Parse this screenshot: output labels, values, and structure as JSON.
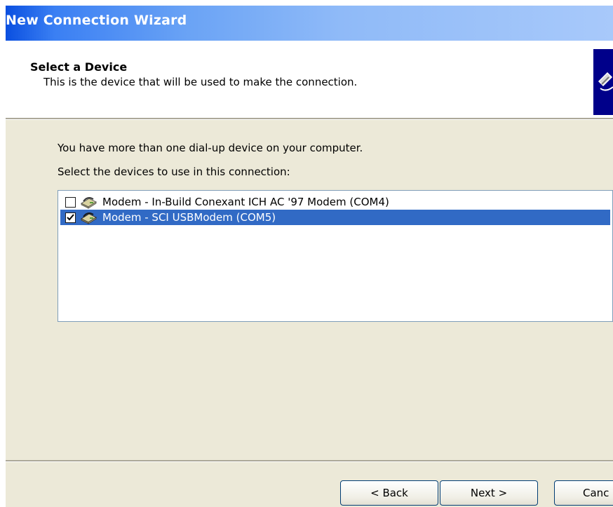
{
  "window": {
    "title": "New Connection Wizard"
  },
  "header": {
    "title": "Select a Device",
    "subtitle": "This is the device that will be used to make the connection.",
    "image_icon": "connection-wizard-icon"
  },
  "body": {
    "intro_text": "You have more than one dial-up device on your computer.",
    "instruction_text": "Select the devices to use in this connection:",
    "devices": [
      {
        "label": "Modem - In-Build Conexant ICH AC '97 Modem (COM4)",
        "checked": false,
        "selected": false,
        "icon": "modem-icon"
      },
      {
        "label": "Modem - SCI USBModem (COM5)",
        "checked": true,
        "selected": true,
        "icon": "modem-icon"
      }
    ]
  },
  "buttons": {
    "back": "< Back",
    "next": "Next >",
    "cancel": "Canc"
  },
  "colors": {
    "title_bar_start": "#0a4fe0",
    "title_bar_end": "#a8c9fa",
    "selection": "#316ac5",
    "dialog_face": "#ece9d8",
    "list_border": "#7f9db9",
    "button_border": "#003c74"
  }
}
